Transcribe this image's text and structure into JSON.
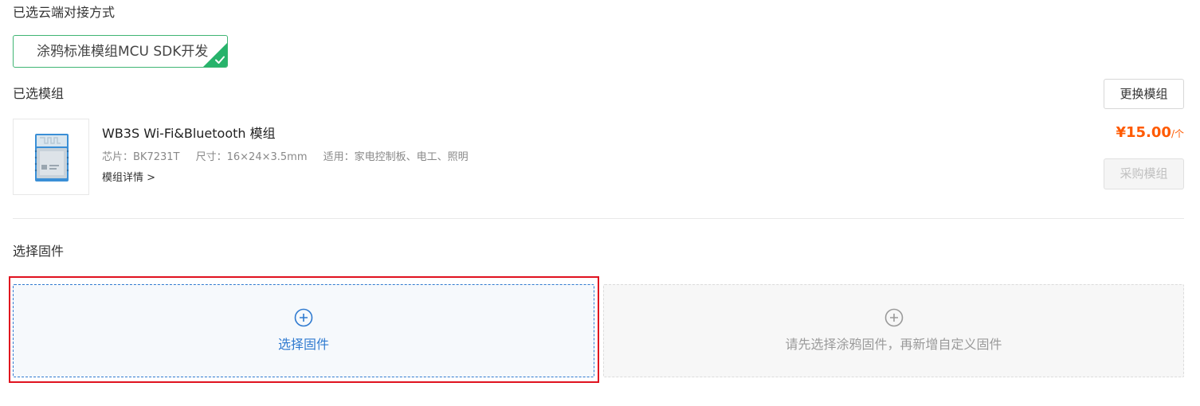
{
  "cloud_method": {
    "section_title": "已选云端对接方式",
    "selected_label": "涂鸦标准模组MCU SDK开发",
    "accent_color": "#27b36b"
  },
  "module": {
    "section_title": "已选模组",
    "replace_button": "更换模组",
    "name": "WB3S Wi-Fi&Bluetooth 模组",
    "chip": "芯片：BK7231T",
    "size": "尺寸：16×24×3.5mm",
    "usage": "适用：家电控制板、电工、照明",
    "details_link": "模组详情 >",
    "price": "¥15.00",
    "price_unit": "/个",
    "purchase_button": "采购模组",
    "price_color": "#ff5a00"
  },
  "firmware": {
    "section_title": "选择固件",
    "select_tile_label": "选择固件",
    "custom_tile_label": "请先选择涂鸦固件，再新增自定义固件",
    "select_color": "#2f7ad0",
    "highlight_color": "#e0121f"
  }
}
